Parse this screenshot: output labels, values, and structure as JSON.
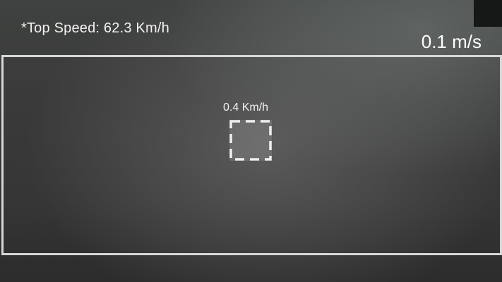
{
  "speedometer": {
    "top_speed_label": "*Top Speed: 62.3 Km/h",
    "current_speed": "0.1 m/s",
    "tracked_object_speed": "0.4 Km/h"
  },
  "colors": {
    "frame_border": "#d7d7d7",
    "text": "#ffffff",
    "background": "#3a3a3a"
  }
}
